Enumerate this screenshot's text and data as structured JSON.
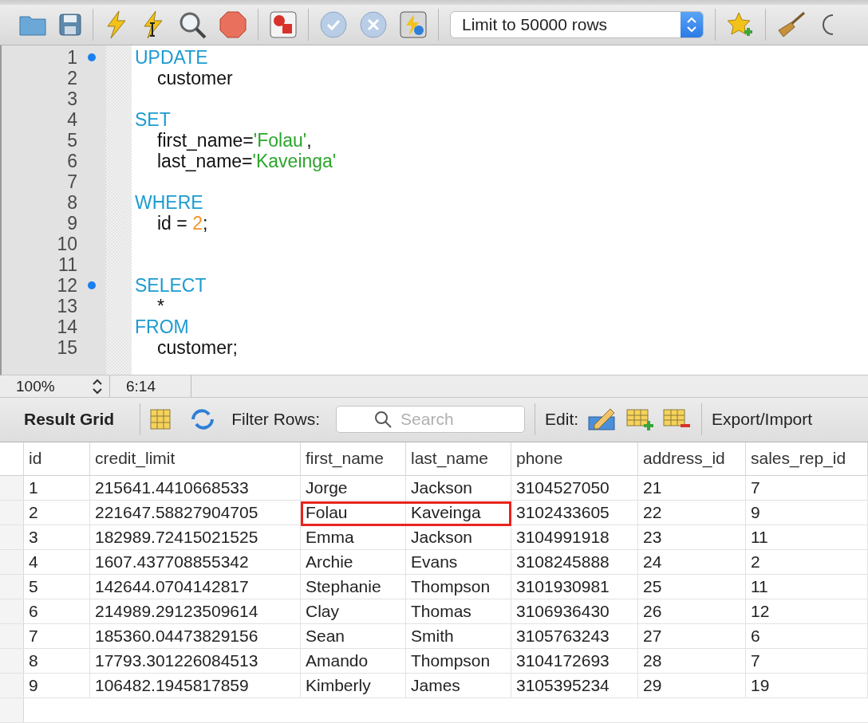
{
  "toolbar": {
    "row_limit": "Limit to 50000 rows"
  },
  "editor": {
    "lines": [
      {
        "number": "1",
        "marker": true,
        "indented": false,
        "tokens": [
          {
            "kind": "keyword",
            "text": "UPDATE"
          }
        ]
      },
      {
        "number": "2",
        "marker": false,
        "indented": true,
        "tokens": [
          {
            "kind": "plain",
            "text": "customer"
          }
        ]
      },
      {
        "number": "3",
        "marker": false
      },
      {
        "number": "4",
        "marker": false,
        "indented": false,
        "tokens": [
          {
            "kind": "keyword",
            "text": "SET"
          }
        ]
      },
      {
        "number": "5",
        "marker": false,
        "indented": true,
        "tokens": [
          {
            "kind": "plain",
            "text": "first_name="
          },
          {
            "kind": "string",
            "text": "'Folau'"
          },
          {
            "kind": "plain",
            "text": ","
          }
        ]
      },
      {
        "number": "6",
        "marker": false,
        "indented": true,
        "tokens": [
          {
            "kind": "plain",
            "text": "last_name="
          },
          {
            "kind": "string",
            "text": "'Kaveinga'"
          }
        ]
      },
      {
        "number": "7",
        "marker": false
      },
      {
        "number": "8",
        "marker": false,
        "indented": false,
        "tokens": [
          {
            "kind": "keyword",
            "text": "WHERE"
          }
        ]
      },
      {
        "number": "9",
        "marker": false,
        "indented": true,
        "tokens": [
          {
            "kind": "plain",
            "text": "id = "
          },
          {
            "kind": "number",
            "text": "2"
          },
          {
            "kind": "plain",
            "text": ";"
          }
        ]
      },
      {
        "number": "10",
        "marker": false
      },
      {
        "number": "11",
        "marker": false
      },
      {
        "number": "12",
        "marker": true,
        "indented": false,
        "tokens": [
          {
            "kind": "keyword",
            "text": "SELECT"
          }
        ]
      },
      {
        "number": "13",
        "marker": false,
        "indented": true,
        "tokens": [
          {
            "kind": "plain",
            "text": "*"
          }
        ]
      },
      {
        "number": "14",
        "marker": false,
        "indented": false,
        "tokens": [
          {
            "kind": "keyword",
            "text": "FROM"
          }
        ]
      },
      {
        "number": "15",
        "marker": false,
        "indented": true,
        "tokens": [
          {
            "kind": "plain",
            "text": "customer;"
          }
        ]
      }
    ]
  },
  "status_bar": {
    "zoom": "100%",
    "cursor": "6:14"
  },
  "result_toolbar": {
    "title": "Result Grid",
    "filter_label": "Filter Rows:",
    "search_placeholder": "Search",
    "edit_label": "Edit:",
    "export_label": "Export/Import"
  },
  "table": {
    "columns": [
      "id",
      "credit_limit",
      "first_name",
      "last_name",
      "phone",
      "address_id",
      "sales_rep_id"
    ],
    "rows": [
      {
        "highlighted": false,
        "cells": [
          "1",
          "215641.4410668533",
          "Jorge",
          "Jackson",
          "3104527050",
          "21",
          "7"
        ]
      },
      {
        "highlighted": true,
        "cells": [
          "2",
          "221647.58827904705",
          "Folau",
          "Kaveinga",
          "3102433605",
          "22",
          "9"
        ]
      },
      {
        "highlighted": false,
        "cells": [
          "3",
          "182989.72415021525",
          "Emma",
          "Jackson",
          "3104991918",
          "23",
          "11"
        ]
      },
      {
        "highlighted": false,
        "cells": [
          "4",
          "1607.437708855342",
          "Archie",
          "Evans",
          "3108245888",
          "24",
          "2"
        ]
      },
      {
        "highlighted": false,
        "cells": [
          "5",
          "142644.0704142817",
          "Stephanie",
          "Thompson",
          "3101930981",
          "25",
          "11"
        ]
      },
      {
        "highlighted": false,
        "cells": [
          "6",
          "214989.29123509614",
          "Clay",
          "Thomas",
          "3106936430",
          "26",
          "12"
        ]
      },
      {
        "highlighted": false,
        "cells": [
          "7",
          "185360.04473829156",
          "Sean",
          "Smith",
          "3105763243",
          "27",
          "6"
        ]
      },
      {
        "highlighted": false,
        "cells": [
          "8",
          "17793.301226084513",
          "Amando",
          "Thompson",
          "3104172693",
          "28",
          "7"
        ]
      },
      {
        "highlighted": false,
        "cells": [
          "9",
          "106482.1945817859",
          "Kimberly",
          "James",
          "3105395234",
          "29",
          "19"
        ]
      }
    ]
  }
}
